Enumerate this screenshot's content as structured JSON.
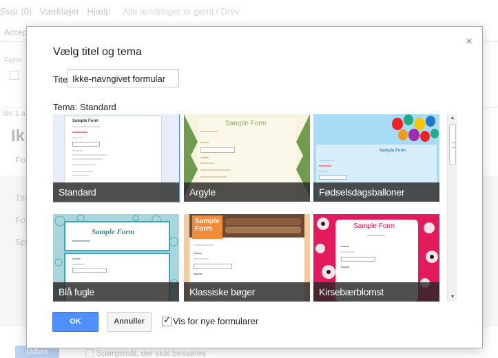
{
  "background": {
    "menu": [
      "Svar (0)",
      "Værktøjer",
      "Hjælp"
    ],
    "saved_status": "Alle ændringer er gemt i Drev",
    "accept_label": "Accep",
    "side_label": "Form",
    "page_info": "ide 1 a",
    "form_title_fragment": "Ik",
    "fo_fragment": "Fo",
    "row_titel": "Tite",
    "row_form": "For",
    "row_spor": "Spo",
    "required_question": "Spørgsmål, der skal besvares",
    "blue_button": "Udført"
  },
  "dialog": {
    "title": "Vælg titel og tema",
    "title_label": "Titel",
    "title_value": "Ikke-navngivet formular",
    "theme_label": "Tema: Standard",
    "themes": [
      {
        "name": "Standard",
        "sample": "Sample Form",
        "selected": true
      },
      {
        "name": "Argyle",
        "sample": "Sample Form",
        "selected": false
      },
      {
        "name": "Fødselsdagsballoner",
        "sample": "Sample Form",
        "selected": false
      },
      {
        "name": "Blå fugle",
        "sample": "Sample Form",
        "selected": false
      },
      {
        "name": "Klassiske bøger",
        "sample": "Sample Form",
        "selected": false
      },
      {
        "name": "Kirsebærblomst",
        "sample": "Sample Form",
        "selected": false
      }
    ],
    "ok_label": "OK",
    "cancel_label": "Annuller",
    "checkbox_label": "Vis for nye formularer",
    "checkbox_checked": true,
    "close_symbol": "×",
    "check_symbol": "✓"
  },
  "colors": {
    "accent": "#4d90fe",
    "caption_bg": "#282828",
    "argyle_green": "#6f9b4e",
    "balloon_sky": "#a6dcf5",
    "bluebird_teal": "#3aa6b9",
    "books_orange": "#f28c38",
    "cherry_pink": "#e41b5a"
  }
}
